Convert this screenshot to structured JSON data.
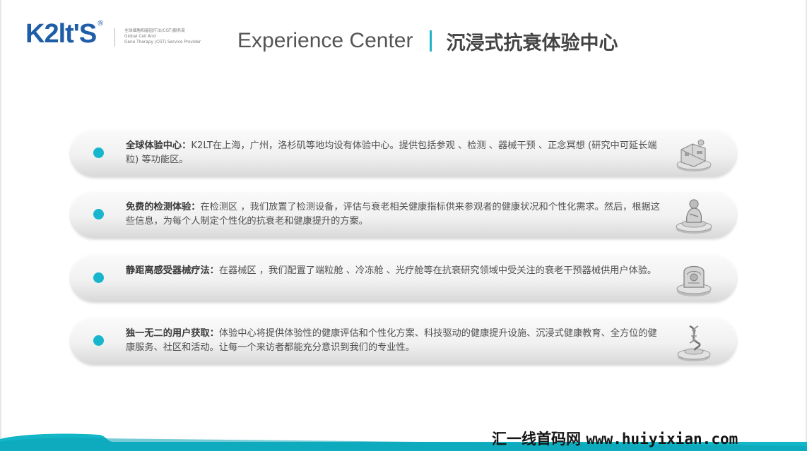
{
  "logo": {
    "brand": "K2lt'S",
    "reg_mark": "®",
    "tagline_cn": "全球细胞和基因疗法(CGT)服务商",
    "tagline_en_1": "Global Cell And",
    "tagline_en_2": "Gene Therapy (CGT) Service Provider"
  },
  "header": {
    "title_en": "Experience Center",
    "title_cn": "沉浸式抗衰体验中心"
  },
  "cards": [
    {
      "key": "全球体验中心：",
      "body": "K2LT在上海，广州，洛杉矶等地均设有体验中心。提供包括参观 、检测 、器械干预 、正念冥想 (研究中可延长端粒) 等功能区。",
      "icon": "lab-building-icon"
    },
    {
      "key": "免费的检测体验：",
      "body": "在检测区 ，我们放置了检测设备，评估与衰老相关健康指标供来参观者的健康状况和个性化需求。然后，根据这些信息，为每个人制定个性化的抗衰老和健康提升的方案。",
      "icon": "test-device-icon"
    },
    {
      "key": "静距离感受器械疗法：",
      "body": "在器械区 ，我们配置了端粒舱 、冷冻舱 、光疗舱等在抗衰研究领域中受关注的衰老干预器械供用户体验。",
      "icon": "therapy-pod-icon"
    },
    {
      "key": "独一无二的用户获取：",
      "body": "体验中心将提供体验性的健康评估和个性化方案、科技驱动的健康提升设施、沉浸式健康教育、全方位的健康服务、社区和活动。让每一个来访者都能充分意识到我们的专业性。",
      "icon": "dna-pedestal-icon"
    }
  ],
  "watermark": {
    "cn": "汇一线首码网",
    "url": "www.huiyixian.com"
  },
  "colors": {
    "accent": "#17b6cd",
    "brand_blue": "#1f5da8",
    "footer_teal": "#12b6c6"
  }
}
